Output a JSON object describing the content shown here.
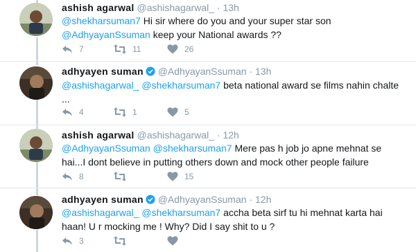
{
  "tweets": [
    {
      "name": "ashish agarwal",
      "handle": "@ashishagarwal_",
      "time": "13h",
      "lines": [
        [
          {
            "t": "@shekharsuman7",
            "m": true
          },
          {
            "t": " Hi sir where do you and your super star son",
            "m": false
          }
        ],
        [
          {
            "t": "@AdhyayanSsuman",
            "m": true
          },
          {
            "t": " keep your National awards  ??",
            "m": false
          }
        ]
      ],
      "replies": "7",
      "retweets": "11",
      "likes": "26",
      "verified": false
    },
    {
      "name": "adhyayen suman",
      "handle": "@AdhyayanSsuman",
      "time": "13h",
      "lines": [
        [
          {
            "t": "@ashishagarwal_",
            "m": true
          },
          {
            "t": " ",
            "m": false
          },
          {
            "t": "@shekharsuman7",
            "m": true
          },
          {
            "t": " beta national award se films nahin chalte",
            "m": false
          }
        ],
        [
          {
            "t": "...",
            "m": false
          }
        ]
      ],
      "replies": "4",
      "retweets": "1",
      "likes": "5",
      "verified": true
    },
    {
      "name": "ashish agarwal",
      "handle": "@ashishagarwal_",
      "time": "12h",
      "lines": [
        [
          {
            "t": "@AdhyayanSsuman",
            "m": true
          },
          {
            "t": " ",
            "m": false
          },
          {
            "t": "@shekharsuman7",
            "m": true
          },
          {
            "t": " Mere pas h job jo apne mehnat se",
            "m": false
          }
        ],
        [
          {
            "t": "hai...I dont believe in putting others down and mock other people failure",
            "m": false
          }
        ]
      ],
      "replies": "8",
      "retweets": "",
      "likes": "15",
      "verified": false
    },
    {
      "name": "adhyayen suman",
      "handle": "@AdhyayanSsuman",
      "time": "12h",
      "lines": [
        [
          {
            "t": "@ashishagarwal_",
            "m": true
          },
          {
            "t": " ",
            "m": false
          },
          {
            "t": "@shekharsuman7",
            "m": true
          },
          {
            "t": " accha beta sirf tu hi mehnat karta hai",
            "m": false
          }
        ],
        [
          {
            "t": "haan! U r mocking me ! Why? Did I say shit to u ?",
            "m": false
          }
        ]
      ],
      "replies": "3",
      "retweets": "",
      "likes": "",
      "verified": true
    }
  ],
  "colors": {
    "mention": "#1da1f2",
    "muted": "#8899a6",
    "verified": "#1da1f2",
    "thread_line": "#ccd6dd"
  },
  "icons": [
    "reply-icon",
    "retweet-icon",
    "like-icon",
    "verified-badge-icon"
  ]
}
